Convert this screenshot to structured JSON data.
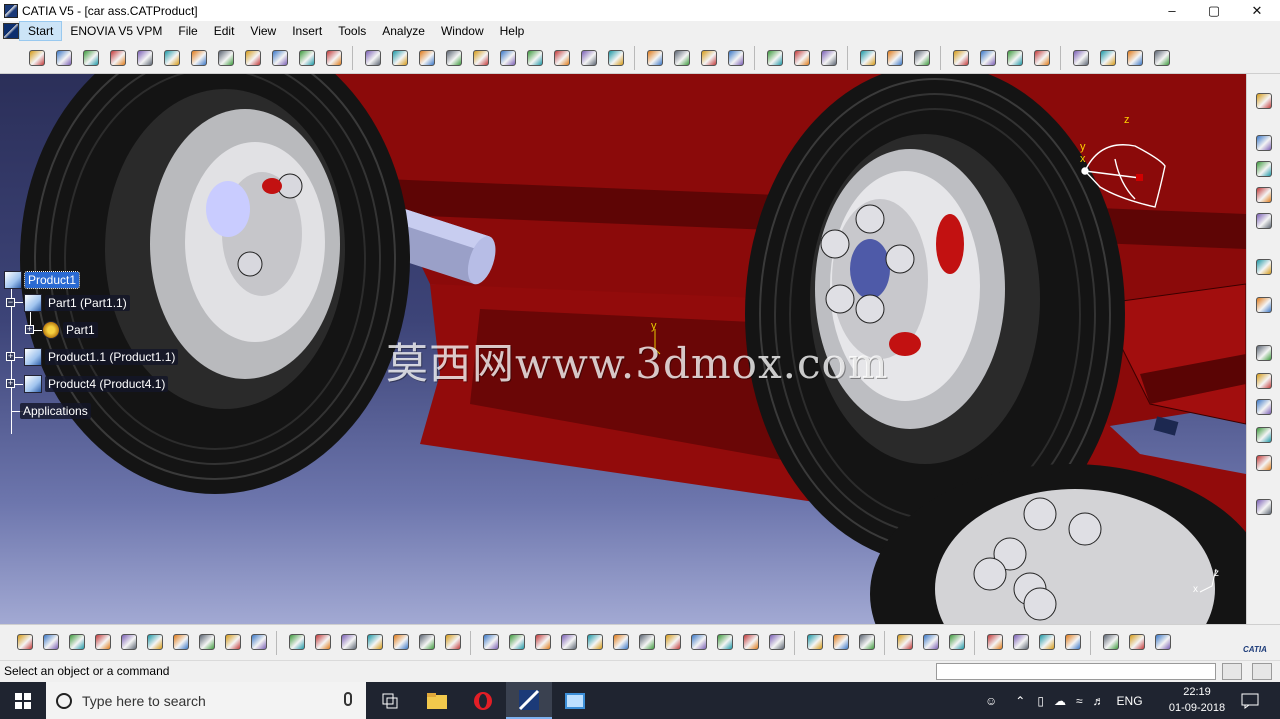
{
  "window": {
    "title": "CATIA V5 - [car ass.CATProduct]",
    "controls": [
      "–",
      "▢",
      "✕"
    ]
  },
  "menubar": {
    "items": [
      {
        "label": "Start"
      },
      {
        "label": "ENOVIA V5 VPM"
      },
      {
        "label": "File"
      },
      {
        "label": "Edit"
      },
      {
        "label": "View"
      },
      {
        "label": "Insert"
      },
      {
        "label": "Tools"
      },
      {
        "label": "Analyze"
      },
      {
        "label": "Window"
      },
      {
        "label": "Help"
      }
    ],
    "mdi_controls": [
      "–",
      "▫",
      "✕"
    ]
  },
  "spec_tree": {
    "root": "Product1",
    "nodes": [
      {
        "label": "Part1 (Part1.1)"
      },
      {
        "label": "Part1"
      },
      {
        "label": "Product1.1 (Product1.1)"
      },
      {
        "label": "Product4 (Product4.1)"
      },
      {
        "label": "Applications"
      }
    ]
  },
  "viewport": {
    "watermark": "莫西网www.3dmox.com",
    "compass_labels": {
      "x": "x",
      "y": "y",
      "z": "z"
    },
    "axis_marker_labels": {
      "y": "y",
      "z": "z",
      "x": "x"
    },
    "colors": {
      "chassis": "#8b0a0a",
      "tire": "#1a1a1a",
      "rim": "#d9d9dc",
      "background_top": "#2b2f59",
      "background_bottom": "#a2a9d3",
      "selection": "#2a6ad2"
    }
  },
  "toolbar_top": {
    "icons": [
      "product-icon",
      "component-icon",
      "existing-component-icon",
      "replace-icon",
      "graph-tree-icon",
      "reorder-icon",
      "numbering-icon",
      "multi-instantiation-icon",
      "fast-multi-instantiation-icon",
      "reconcile-icon",
      "manipulation-icon",
      "snap-icon",
      "explode-icon",
      "stop-manipulate-icon",
      "clash-icon",
      "coincidence-icon",
      "contact-icon",
      "offset-icon",
      "angle-icon",
      "fix-icon",
      "fix-together-icon",
      "quick-constraint-icon",
      "flexible-icon",
      "change-constraint-icon",
      "reuse-pattern-icon",
      "update-icon",
      "scenes-icon",
      "annotation-icon",
      "weld-icon",
      "split-icon",
      "hole-icon",
      "pocket-icon",
      "bom-icon",
      "publish-icon",
      "save-management-icon",
      "catalog-icon",
      "insert-catalog-icon",
      "enhanced-scene-icon",
      "sectioning-icon",
      "distance-icon"
    ]
  },
  "toolbar_right": {
    "icons": [
      "compass-tool-icon",
      "product-view-icon",
      "product-view-2-icon",
      "product-view-3-icon",
      "product-view-4-icon",
      "select-arrow-icon",
      "gear-tool-icon",
      "measure-icon",
      "text-abc-icon",
      "flag-icon",
      "thread-icon",
      "cutting-plane-icon",
      "section-icon"
    ]
  },
  "toolbar_bottom": {
    "icons": [
      "new-icon",
      "open-icon",
      "save-icon",
      "print-icon",
      "cut-icon",
      "copy-icon",
      "paste-icon",
      "undo-icon",
      "redo-icon",
      "whats-this-icon",
      "formula-icon",
      "knowledge-icon",
      "measure-item-icon",
      "table-icon",
      "catalog-browser-icon",
      "lock-icon",
      "quick-select-icon",
      "fly-mode-icon",
      "fit-all-icon",
      "pan-icon",
      "rotate-icon",
      "zoom-in-icon",
      "zoom-out-icon",
      "normal-view-icon",
      "multi-view-icon",
      "iso-view-icon",
      "hide-show-icon",
      "swap-visible-icon",
      "render-style-icon",
      "shading-icon",
      "tools-palette-icon",
      "analysis-icon",
      "compare-icon",
      "capture-icon",
      "video-icon",
      "properties-icon",
      "apply-material-icon",
      "plm-icon",
      "measure-between-icon",
      "stl-icon",
      "simulate-icon",
      "catia-logo-icon"
    ],
    "catia_logo_label": "CATIA"
  },
  "statusbar": {
    "message": "Select an object or a command"
  },
  "taskbar": {
    "search_placeholder": "Type here to search",
    "apps": [
      "task-view-icon",
      "file-explorer-icon",
      "opera-browser-icon",
      "catia-app-icon",
      "photos-app-icon"
    ],
    "language": "ENG",
    "time": "22:19",
    "date": "01-09-2018"
  }
}
